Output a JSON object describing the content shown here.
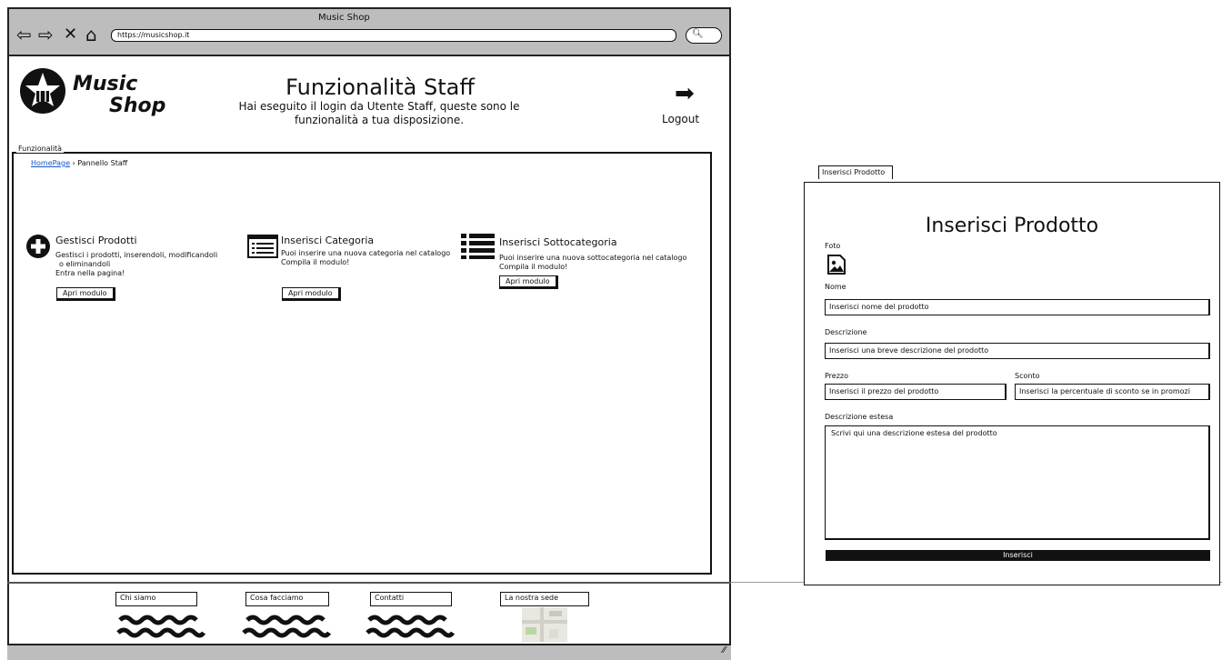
{
  "browser": {
    "window_title": "Music Shop",
    "url": "https://musicshop.it",
    "search_icon": "magnifier-icon",
    "nav_icons": [
      "back-arrow-icon",
      "forward-arrow-icon",
      "stop-icon",
      "home-icon"
    ]
  },
  "header": {
    "logo_line1": "Music",
    "logo_line2": "Shop",
    "title": "Funzionalità Staff",
    "subtitle": "Hai eseguito il login da Utente Staff, queste sono le funzionalità a tua disposizione.",
    "logout_label": "Logout",
    "logout_icon": "logout-arrow-icon"
  },
  "section": {
    "legend": "Funzionalità",
    "breadcrumb": {
      "home": "HomePage",
      "separator": "›",
      "current": "Pannello Staff"
    }
  },
  "cards": [
    {
      "title": "Gestisci Prodotti",
      "icon": "plus-circle-icon",
      "lines": [
        "Gestisci i prodotti, inserendoli, modificandoli",
        "o eliminandoli",
        "Entra nella pagina!"
      ],
      "button": "Apri modulo"
    },
    {
      "title": "Inserisci Categoria",
      "icon": "list-box-icon",
      "lines": [
        "Puoi inserire una nuova categoria nel catalogo",
        "Compila il modulo!"
      ],
      "button": "Apri modulo"
    },
    {
      "title": "Inserisci Sottocategoria",
      "icon": "bulleted-list-icon",
      "lines": [
        "Puoi inserire una nuova sottocategoria nel catalogo",
        "Compila il modulo!"
      ],
      "button": "Apri modulo"
    }
  ],
  "footer": {
    "links": [
      "Chi siamo",
      "Cosa facciamo",
      "Contatti",
      "La nostra sede"
    ]
  },
  "form": {
    "tab": "Inserisci Prodotto",
    "title": "Inserisci Prodotto",
    "foto_label": "Foto",
    "nome_label": "Nome",
    "nome_placeholder": "Inserisci nome del prodotto",
    "descrizione_label": "Descrizione",
    "descrizione_placeholder": "Inserisci una breve descrizione del prodotto",
    "prezzo_label": "Prezzo",
    "prezzo_placeholder": "Inserisci il prezzo del prodotto",
    "sconto_label": "Sconto",
    "sconto_placeholder": "Inserisci la percentuale di sconto se in promozi",
    "estesa_label": "Descrizione estesa",
    "estesa_placeholder": "Scrivi qui una descrizione estesa del prodotto",
    "submit": "Inserisci"
  }
}
